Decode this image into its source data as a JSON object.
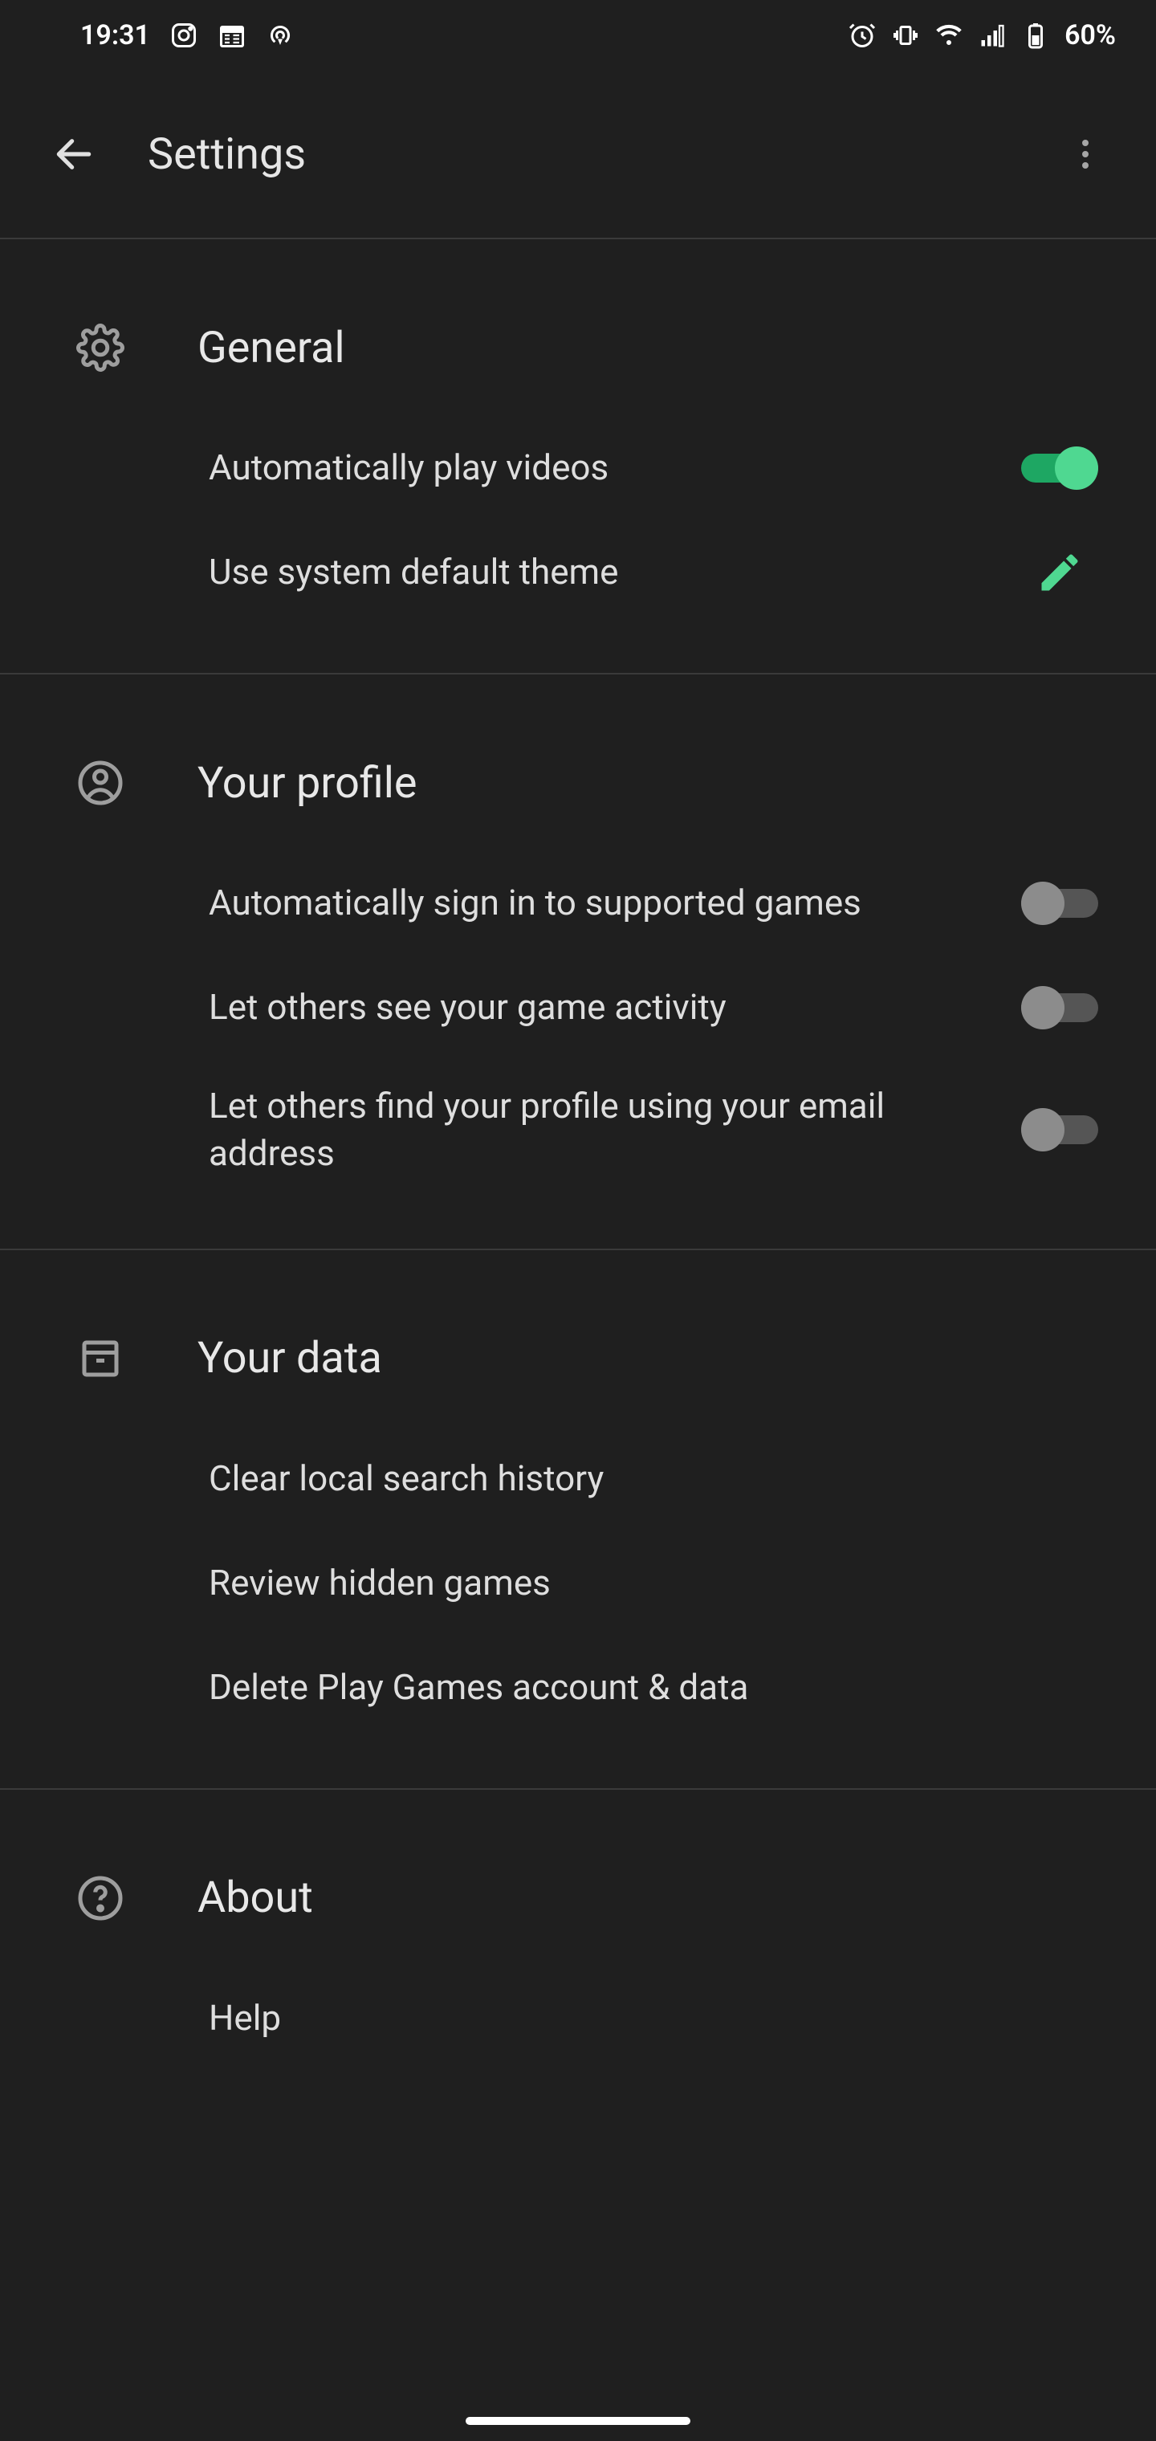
{
  "status": {
    "time": "19:31",
    "battery": "60%"
  },
  "appbar": {
    "title": "Settings"
  },
  "sections": [
    {
      "title": "General",
      "items": [
        {
          "label": "Automatically play videos",
          "toggle": true
        },
        {
          "label": "Use system default theme",
          "edit": true
        }
      ]
    },
    {
      "title": "Your profile",
      "items": [
        {
          "label": "Automatically sign in to supported games",
          "toggle": false
        },
        {
          "label": "Let others see your game activity",
          "toggle": false
        },
        {
          "label": "Let others find your profile using your email address",
          "toggle": false
        }
      ]
    },
    {
      "title": "Your data",
      "items": [
        {
          "label": "Clear local search history"
        },
        {
          "label": "Review hidden games"
        },
        {
          "label": "Delete Play Games account & data"
        }
      ]
    },
    {
      "title": "About",
      "items": [
        {
          "label": "Help"
        }
      ]
    }
  ],
  "colors": {
    "accent": "#4fd891",
    "accentTrack": "#1ea763",
    "bg": "#1f1f1f"
  }
}
